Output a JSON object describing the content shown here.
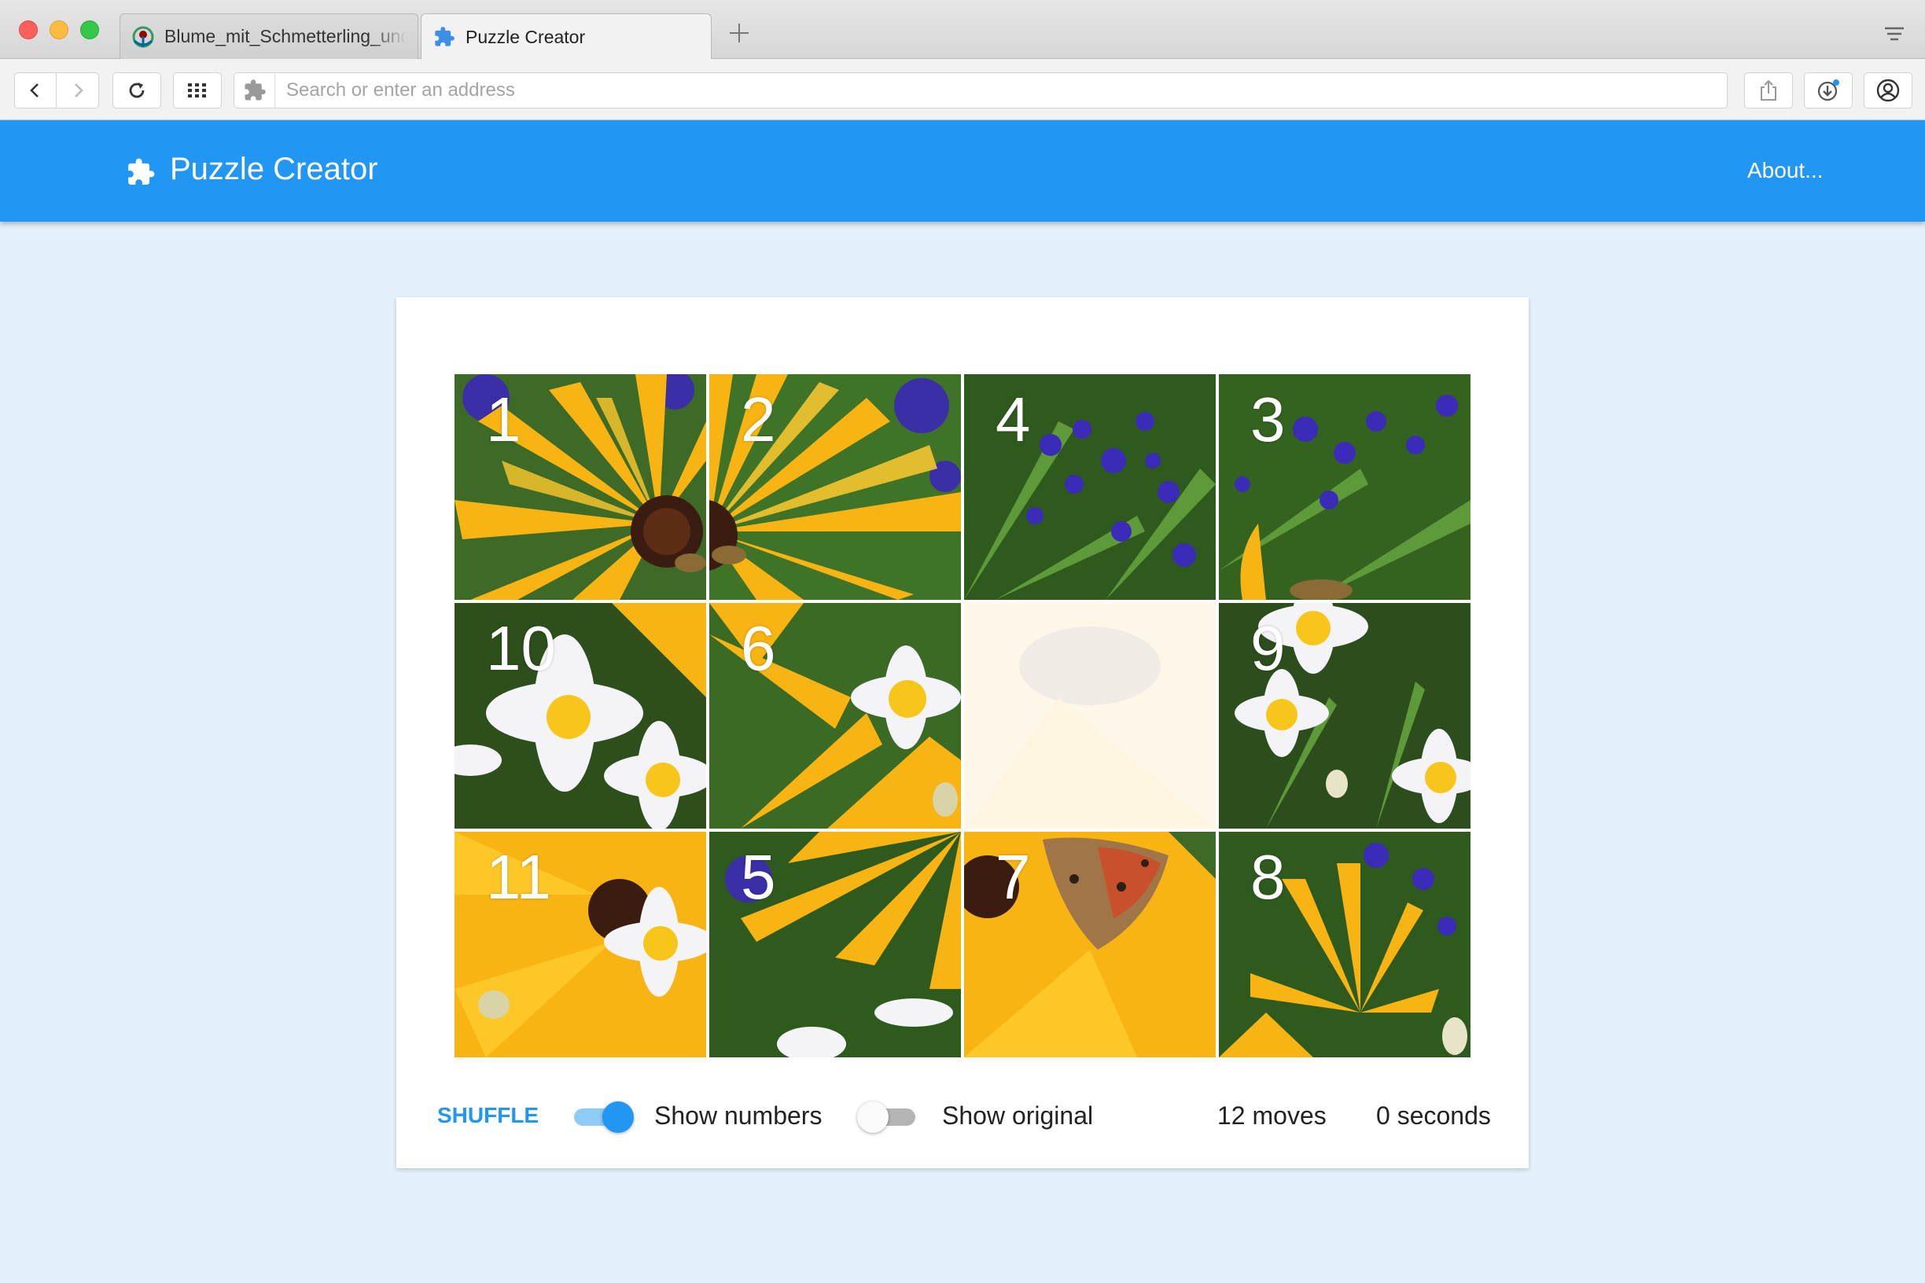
{
  "browser": {
    "tabs": [
      {
        "label": "Blume_mit_Schmetterling_und",
        "icon": "wikimedia-icon",
        "active": false
      },
      {
        "label": "Puzzle Creator",
        "icon": "puzzle-icon",
        "active": true
      }
    ],
    "address_placeholder": "Search or enter an address",
    "address_value": ""
  },
  "app": {
    "title": "Puzzle Creator",
    "about_label": "About...",
    "accent": "#2196f3"
  },
  "puzzle": {
    "tiles": [
      {
        "number": "1"
      },
      {
        "number": "2"
      },
      {
        "number": "4"
      },
      {
        "number": "3"
      },
      {
        "number": "10"
      },
      {
        "number": "6"
      },
      {
        "number": ""
      },
      {
        "number": "9"
      },
      {
        "number": "11"
      },
      {
        "number": "5"
      },
      {
        "number": "7"
      },
      {
        "number": "8"
      }
    ]
  },
  "controls": {
    "shuffle_label": "SHUFFLE",
    "show_numbers_label": "Show numbers",
    "show_numbers_on": true,
    "show_original_label": "Show original",
    "show_original_on": false,
    "moves": "12 moves",
    "seconds": "0 seconds"
  }
}
